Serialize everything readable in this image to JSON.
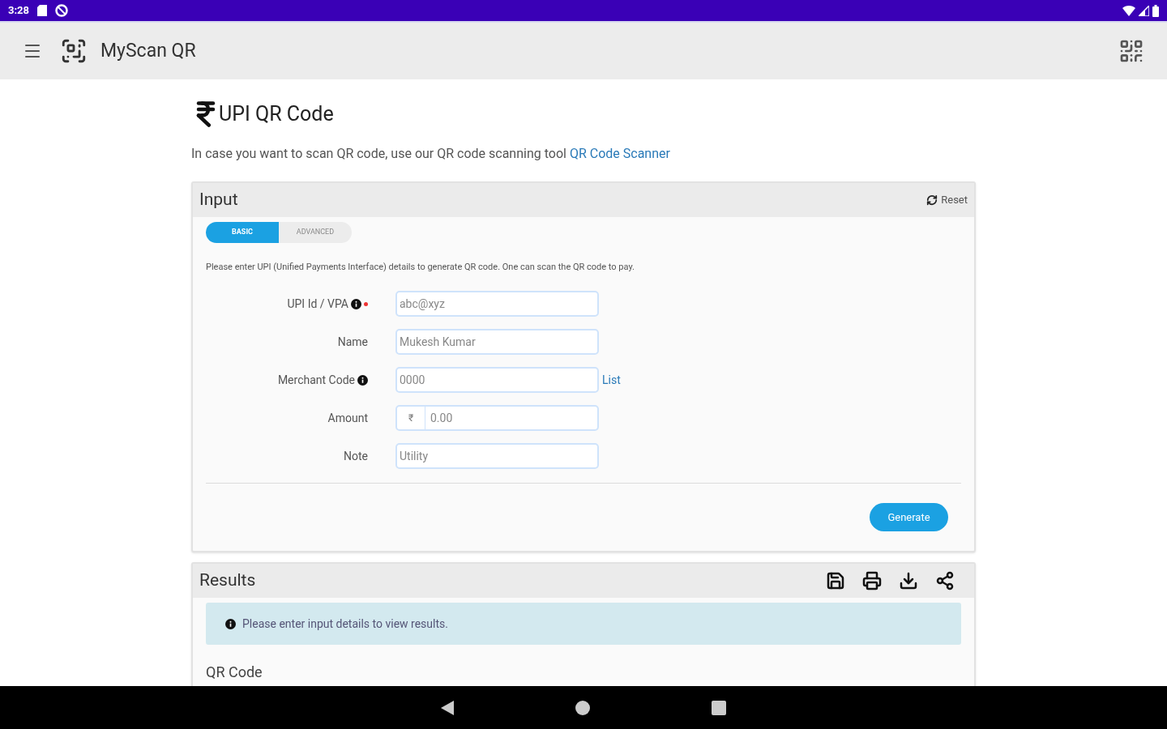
{
  "status_bar": {
    "time": "3:28"
  },
  "app_bar": {
    "title": "MyScan QR"
  },
  "page": {
    "title": "UPI QR Code",
    "intro": "In case you want to scan QR code, use our QR code scanning tool",
    "intro_link": "QR Code Scanner"
  },
  "input_panel": {
    "title": "Input",
    "reset": "Reset",
    "tabs": [
      {
        "label": "BASIC",
        "selected": true
      },
      {
        "label": "ADVANCED",
        "selected": false
      }
    ],
    "description": "Please enter UPI (Unified Payments Interface) details to generate QR code. One can scan the QR code to pay.",
    "fields": [
      {
        "label": "UPI Id / VPA",
        "info": true,
        "required": true,
        "placeholder": "abc@xyz"
      },
      {
        "label": "Name",
        "info": false,
        "required": false,
        "placeholder": "Mukesh Kumar"
      },
      {
        "label": "Merchant Code",
        "info": true,
        "required": false,
        "placeholder": "0000",
        "link": "List"
      },
      {
        "label": "Amount",
        "info": false,
        "required": false,
        "prefix": "₹",
        "placeholder": "0.00"
      },
      {
        "label": "Note",
        "info": false,
        "required": false,
        "placeholder": "Utility"
      }
    ],
    "generate": "Generate"
  },
  "results_panel": {
    "title": "Results",
    "message": "Please enter input details to view results.",
    "section": "QR Code"
  }
}
